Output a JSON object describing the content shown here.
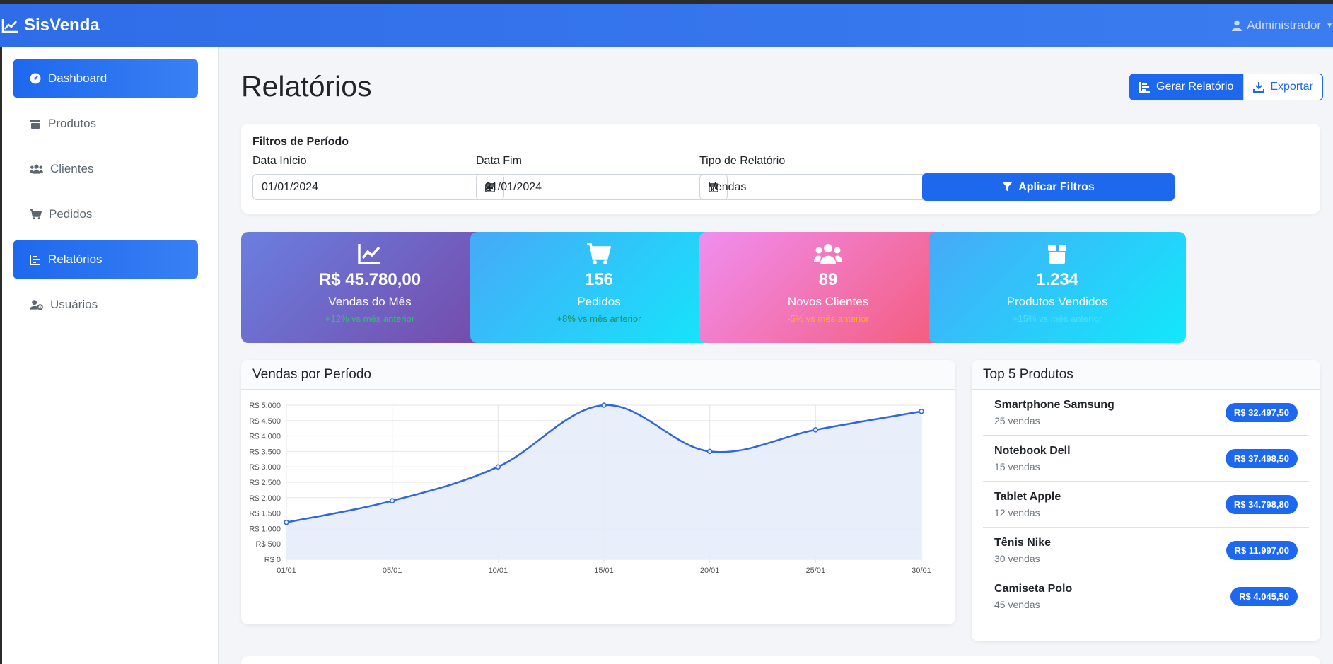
{
  "app": {
    "brand": "SisVenda",
    "user": "Administrador"
  },
  "sidebar": {
    "items": [
      {
        "label": "Dashboard",
        "icon": "gauge-icon"
      },
      {
        "label": "Produtos",
        "icon": "box-icon"
      },
      {
        "label": "Clientes",
        "icon": "users-icon"
      },
      {
        "label": "Pedidos",
        "icon": "cart-icon"
      },
      {
        "label": "Relatórios",
        "icon": "chart-icon"
      },
      {
        "label": "Usuários",
        "icon": "user-gear-icon"
      }
    ]
  },
  "page": {
    "title": "Relatórios",
    "generate_label": "Gerar Relatório",
    "export_label": "Exportar"
  },
  "filters": {
    "title": "Filtros de Período",
    "start_label": "Data Início",
    "start_value": "01/01/2024",
    "end_label": "Data Fim",
    "end_value": "31/01/2024",
    "type_label": "Tipo de Relatório",
    "type_value": "Vendas",
    "apply_label": "Aplicar Filtros"
  },
  "stats": [
    {
      "value": "R$ 45.780,00",
      "label": "Vendas do Mês",
      "change": "+12% vs mês anterior",
      "change_color": "#2fbf71",
      "gradient": [
        "#6a7fe0",
        "#7549a8"
      ]
    },
    {
      "value": "156",
      "label": "Pedidos",
      "change": "+8% vs mês anterior",
      "change_color": "#1f8f60",
      "gradient": [
        "#47a9f8",
        "#12e8fb"
      ]
    },
    {
      "value": "89",
      "label": "Novos Clientes",
      "change": "-5% vs mês anterior",
      "change_color": "#ffb020",
      "gradient": [
        "#f08ef0",
        "#f45a78"
      ]
    },
    {
      "value": "1.234",
      "label": "Produtos Vendidos",
      "change": "+15% vs mês anterior",
      "change_color": "#4fdff0",
      "gradient": [
        "#47a9f8",
        "#12e8fb"
      ]
    }
  ],
  "chart": {
    "header": "Vendas por Período"
  },
  "chart_data": {
    "type": "area",
    "categories": [
      "01/01",
      "05/01",
      "10/01",
      "15/01",
      "20/01",
      "25/01",
      "30/01"
    ],
    "values": [
      1200,
      1900,
      3000,
      5000,
      3500,
      4200,
      4800
    ],
    "ylim": [
      0,
      5000
    ],
    "yticks": [
      "R$ 0",
      "R$ 500",
      "R$ 1.000",
      "R$ 1.500",
      "R$ 2.000",
      "R$ 2.500",
      "R$ 3.000",
      "R$ 3.500",
      "R$ 4.000",
      "R$ 4.500",
      "R$ 5.000"
    ],
    "grid": true,
    "line_color": "#2f66e0",
    "fill_color": "#e6edfb"
  },
  "top_products": {
    "header": "Top 5 Produtos",
    "items": [
      {
        "name": "Smartphone Samsung",
        "sales": "25 vendas",
        "price": "R$ 32.497,50"
      },
      {
        "name": "Notebook Dell",
        "sales": "15 vendas",
        "price": "R$ 37.498,50"
      },
      {
        "name": "Tablet Apple",
        "sales": "12 vendas",
        "price": "R$ 34.798,80"
      },
      {
        "name": "Tênis Nike",
        "sales": "30 vendas",
        "price": "R$ 11.997,00"
      },
      {
        "name": "Camiseta Polo",
        "sales": "45 vendas",
        "price": "R$ 4.045,50"
      }
    ]
  }
}
